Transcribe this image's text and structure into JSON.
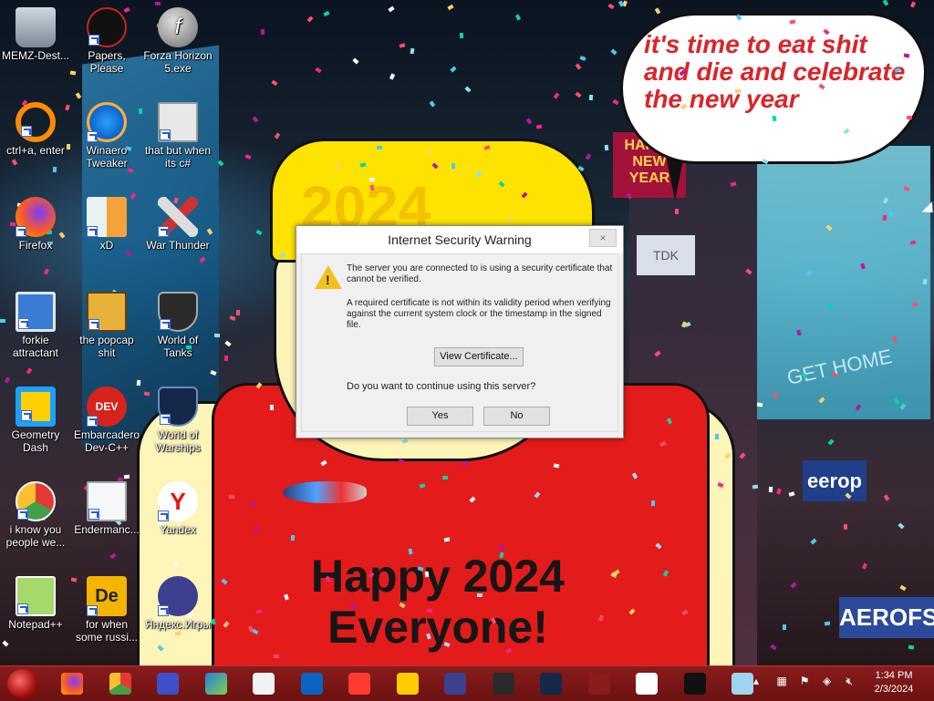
{
  "desktop": {
    "icons": [
      {
        "label": "MEMZ-Dest...",
        "icon": "recycle-bin-icon"
      },
      {
        "label": "Papers, Please",
        "icon": "papers-please-icon"
      },
      {
        "label": "Forza Horizon 5.exe",
        "icon": "flash-icon"
      },
      {
        "label": "ctrl+a, enter",
        "icon": "orange-ring-icon"
      },
      {
        "label": "Winaero Tweaker",
        "icon": "winaero-icon"
      },
      {
        "label": "that but when its c#",
        "icon": "stack-icon"
      },
      {
        "label": "Firefox",
        "icon": "firefox-icon"
      },
      {
        "label": "xD",
        "icon": "xd-icon"
      },
      {
        "label": "War Thunder",
        "icon": "war-thunder-icon"
      },
      {
        "label": "forkie attractant",
        "icon": "settings-monitor-icon"
      },
      {
        "label": "the popcap shit",
        "icon": "popcap-icon"
      },
      {
        "label": "World of Tanks",
        "icon": "world-of-tanks-icon"
      },
      {
        "label": "Geometry Dash",
        "icon": "geometry-dash-icon"
      },
      {
        "label": "Embarcadero Dev-C++",
        "icon": "dev-cpp-icon"
      },
      {
        "label": "World of Warships",
        "icon": "world-of-warships-icon"
      },
      {
        "label": "i know you people we...",
        "icon": "chrome-icon"
      },
      {
        "label": "Endermanc...",
        "icon": "document-icon"
      },
      {
        "label": "Yandex",
        "icon": "yandex-icon"
      },
      {
        "label": "Notepad++",
        "icon": "notepad-plus-plus-icon"
      },
      {
        "label": "for when some russi...",
        "icon": "de-icon"
      },
      {
        "label": "Яндекс.Игры",
        "icon": "gamepad-icon"
      }
    ]
  },
  "wallpaper": {
    "bubble_line1": "it's time to eat shit",
    "bubble_line2": "and die and celebrate",
    "bubble_line3": "the new year",
    "hat_text": "2024",
    "happy_line1": "Happy 2024",
    "happy_line2": "Everyone!",
    "sign_new_year": "HAPPY NEW YEAR",
    "sign_tdk": "TDK",
    "sign_get_home": "GET HOME",
    "sign_europe": "eerop",
    "sign_aero": "AEROFS"
  },
  "dialog": {
    "title": "Internet Security Warning",
    "close_label": "×",
    "message1": "The server you are connected to is using a security certificate that cannot be verified.",
    "message2": "A required certificate is not within its validity period when verifying against the current system clock or the timestamp in the signed file.",
    "view_certificate_label": "View Certificate...",
    "question": "Do you want to continue using this server?",
    "yes_label": "Yes",
    "no_label": "No"
  },
  "taskbar": {
    "apps": [
      "firefox-icon",
      "chrome-icon",
      "settings-icon",
      "task-manager-icon",
      "7zip-icon",
      "outlook-icon",
      "yandex-browser-icon",
      "yandex-music-icon",
      "gamepad-icon",
      "world-of-tanks-icon",
      "world-of-warships-icon",
      "war-thunder-icon",
      "yandex-icon",
      "command-prompt-icon",
      "notepad-icon"
    ],
    "time": "1:34 PM",
    "date": "2/3/2024"
  },
  "colors": {
    "taskbar": "#7a1616",
    "dialog_bg": "#f0f0f0",
    "bubble_text": "#d9252a",
    "hat": "#ffe300",
    "shirt": "#e31b1b"
  }
}
